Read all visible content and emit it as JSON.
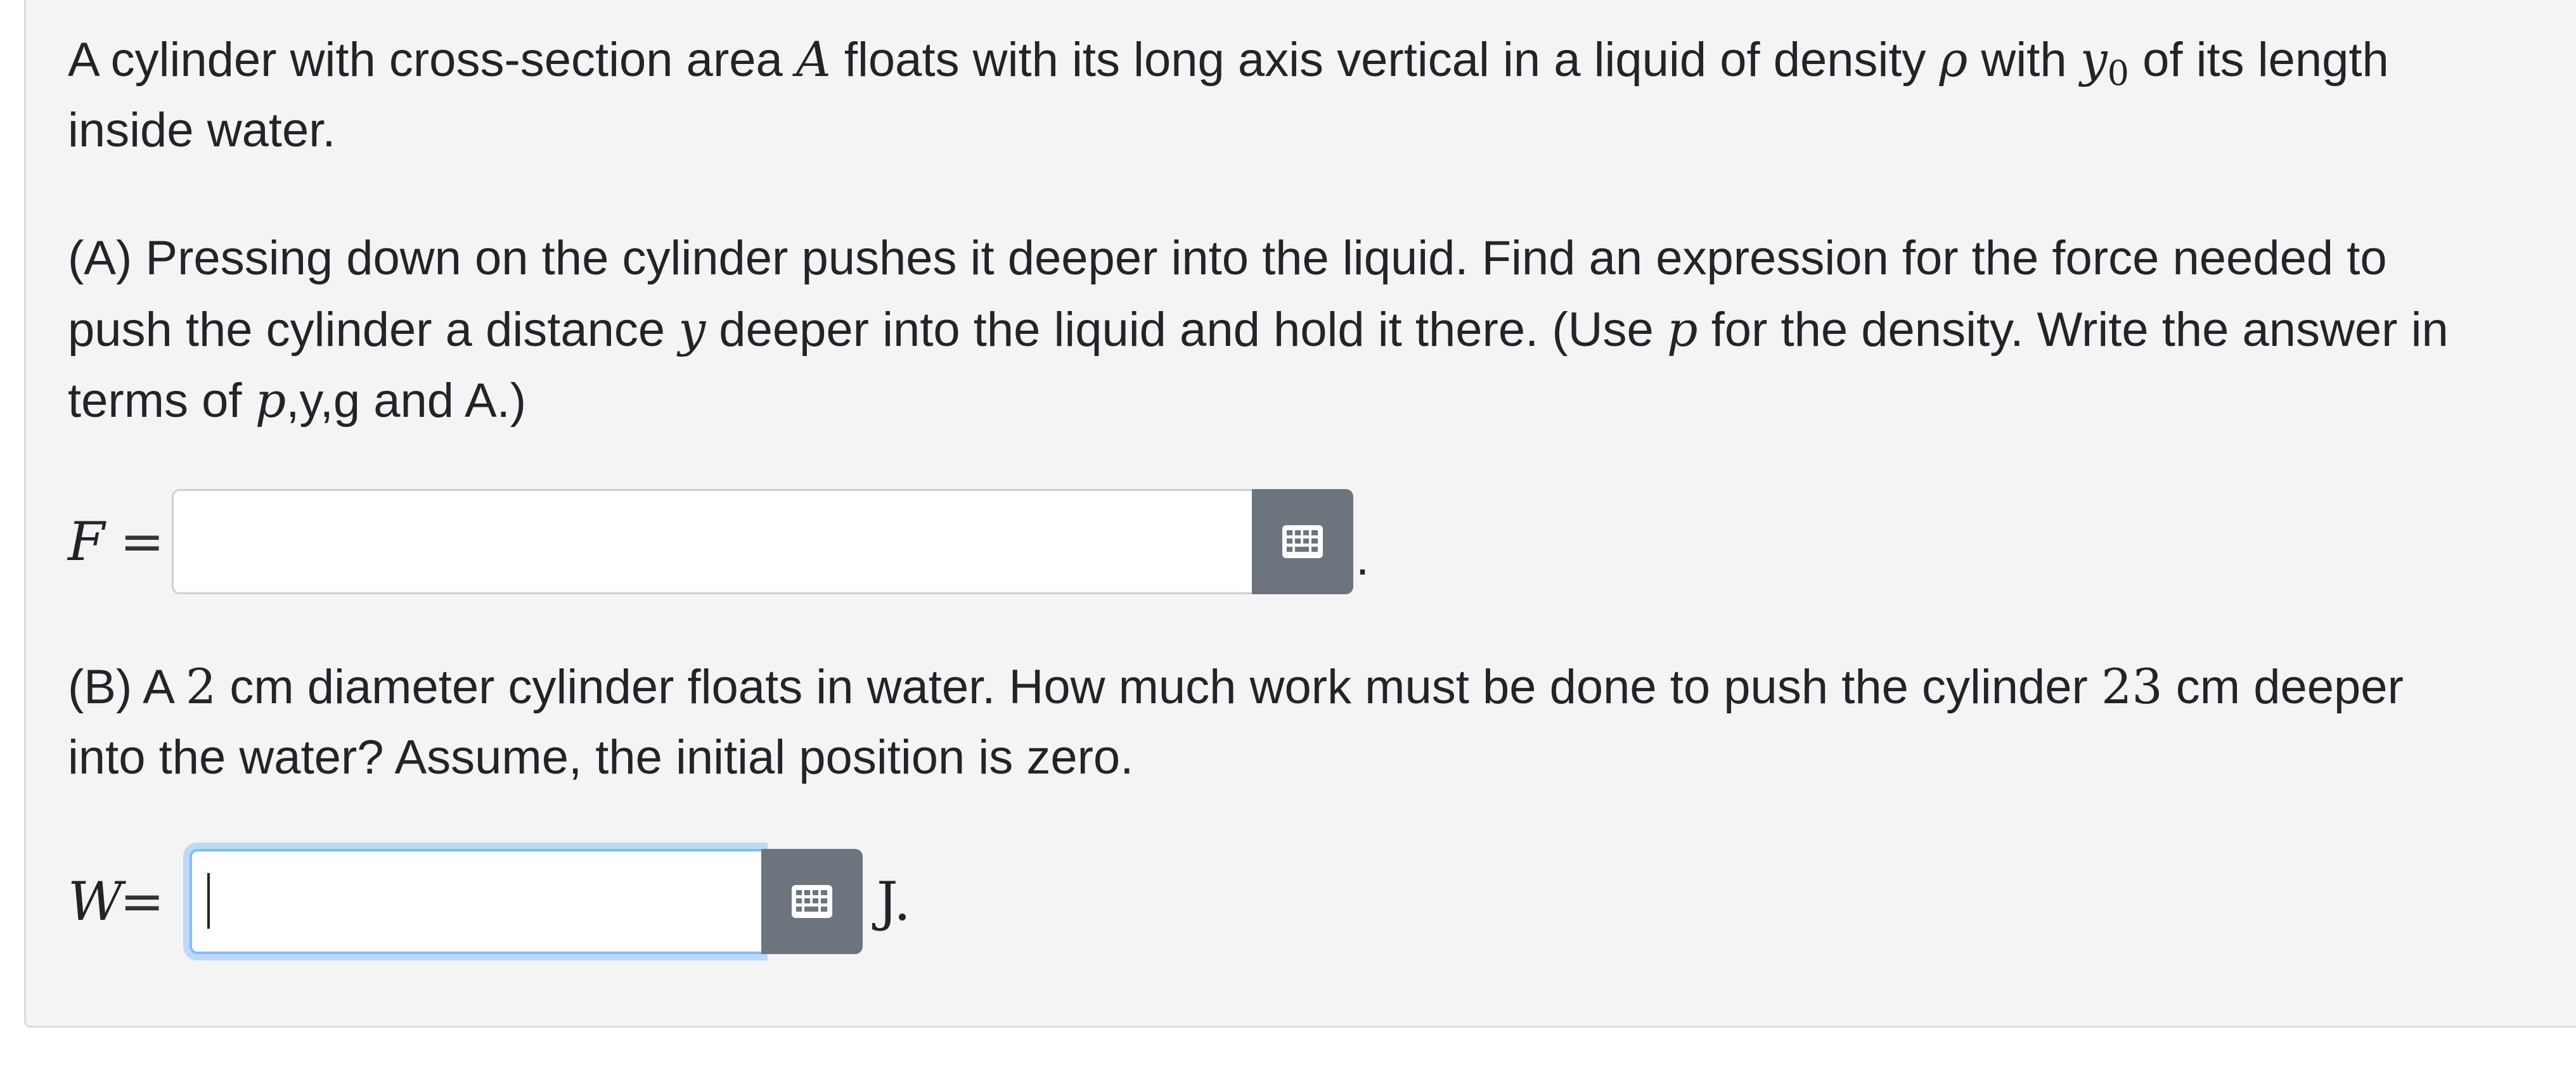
{
  "intro": {
    "t1": "A cylinder with cross-section area ",
    "m_A": "A",
    "t2": " floats with its long axis vertical in a liquid of density ",
    "m_rho": "ρ",
    "t3": " with ",
    "m_y": "y",
    "m_sub0": "0",
    "t4": " of its length",
    "line2": "inside water."
  },
  "part_a": {
    "l1": "(A) Pressing down on the cylinder pushes it deeper into the liquid. Find an expression for the force needed to",
    "l2a": "push the cylinder a distance ",
    "m_y": "y",
    "l2b": " deeper into the liquid and hold it there. (Use ",
    "m_p": "p",
    "l2c": " for the density. Write the answer in",
    "l3a": "terms of ",
    "m_p2": "p",
    "l3b": ",y,g and A.)",
    "answer": {
      "variable": "F",
      "equals": "=",
      "value": "",
      "trailing": "."
    }
  },
  "part_b": {
    "l1a": "(B) A ",
    "n_2": "2",
    "l1b": " cm diameter cylinder floats in water. How much work must be done to push the cylinder ",
    "n_23": "23",
    "l1c": " cm deeper",
    "l2": "into the water? Assume, the initial position is zero.",
    "answer": {
      "variable": "W",
      "equals": "=",
      "value": "",
      "unit": "J."
    }
  },
  "icons": {
    "keyboard": "keyboard-icon"
  },
  "colors": {
    "panel_bg": "#f4f4f4",
    "button_bg": "#6c757d",
    "focus_ring": "#80bdff"
  }
}
